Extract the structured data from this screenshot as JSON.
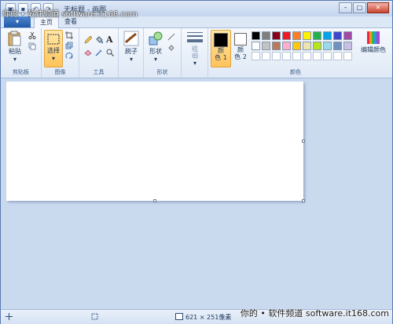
{
  "title": "无标题 - 画图",
  "caption": {
    "min": "–",
    "max": "□",
    "close": "✕"
  },
  "tabs": {
    "app_menu": "▾",
    "home": "主页",
    "view": "查看"
  },
  "groups": {
    "clipboard": {
      "label": "剪贴板",
      "paste": "粘贴"
    },
    "image": {
      "label": "图像",
      "select": "选择"
    },
    "tools": {
      "label": "工具"
    },
    "brushes": {
      "label": "刷子"
    },
    "shapes": {
      "label": "形状",
      "shapes_btn": "形状"
    },
    "size": {
      "label": "粗\n细"
    },
    "colors": {
      "label": "颜色",
      "color1": "颜\n色 1",
      "color2": "颜\n色 2",
      "edit": "编辑颜色"
    }
  },
  "palette": [
    "#000000",
    "#7f7f7f",
    "#880015",
    "#ed1c24",
    "#ff7f27",
    "#fff200",
    "#22b14c",
    "#00a2e8",
    "#3f48cc",
    "#a349a4",
    "#ffffff",
    "#c3c3c3",
    "#b97a57",
    "#ffaec9",
    "#ffc90e",
    "#efe4b0",
    "#b5e61d",
    "#99d9ea",
    "#7092be",
    "#c8bfe7",
    "#ffffff",
    "#ffffff",
    "#ffffff",
    "#ffffff",
    "#ffffff",
    "#ffffff",
    "#ffffff",
    "#ffffff",
    "#ffffff",
    "#ffffff"
  ],
  "color1": "#000000",
  "color2": "#ffffff",
  "status": {
    "size": "621 × 251像素"
  },
  "watermark": {
    "top": "你的 • 软件频道 software.it168.com",
    "bottom": "你的 • 软件频道 software.it168.com"
  }
}
